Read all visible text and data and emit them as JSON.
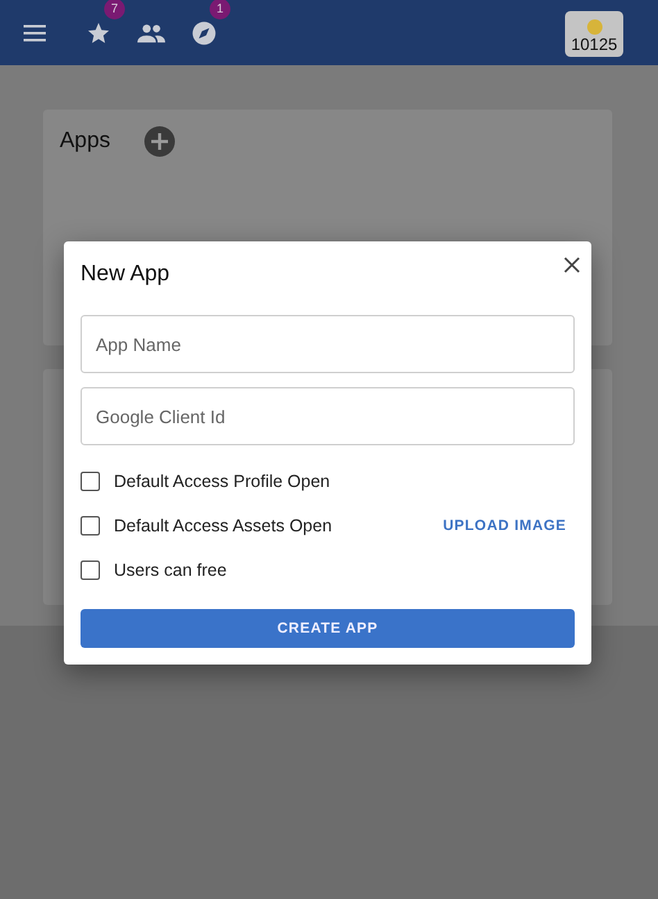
{
  "app_bar": {
    "badges": [
      {
        "kind": "star",
        "count": "7"
      },
      {
        "kind": "people"
      },
      {
        "kind": "compass",
        "count": "1"
      }
    ],
    "coins": "10125"
  },
  "cards": [
    {
      "title": "Apps",
      "add": true
    },
    {
      "add": false
    }
  ],
  "dialog": {
    "title": "New App",
    "fields": [
      {
        "placeholder": "App Name"
      },
      {
        "placeholder": "Google Client Id"
      }
    ],
    "checkboxes": [
      {
        "label": "Default Access Profile Open",
        "checked": false
      },
      {
        "label": "Default Access Assets Open",
        "checked": false
      },
      {
        "label": "Users can free",
        "checked": false
      }
    ],
    "upload_button": "UPLOAD IMAGE",
    "create_button": "CREATE APP"
  }
}
